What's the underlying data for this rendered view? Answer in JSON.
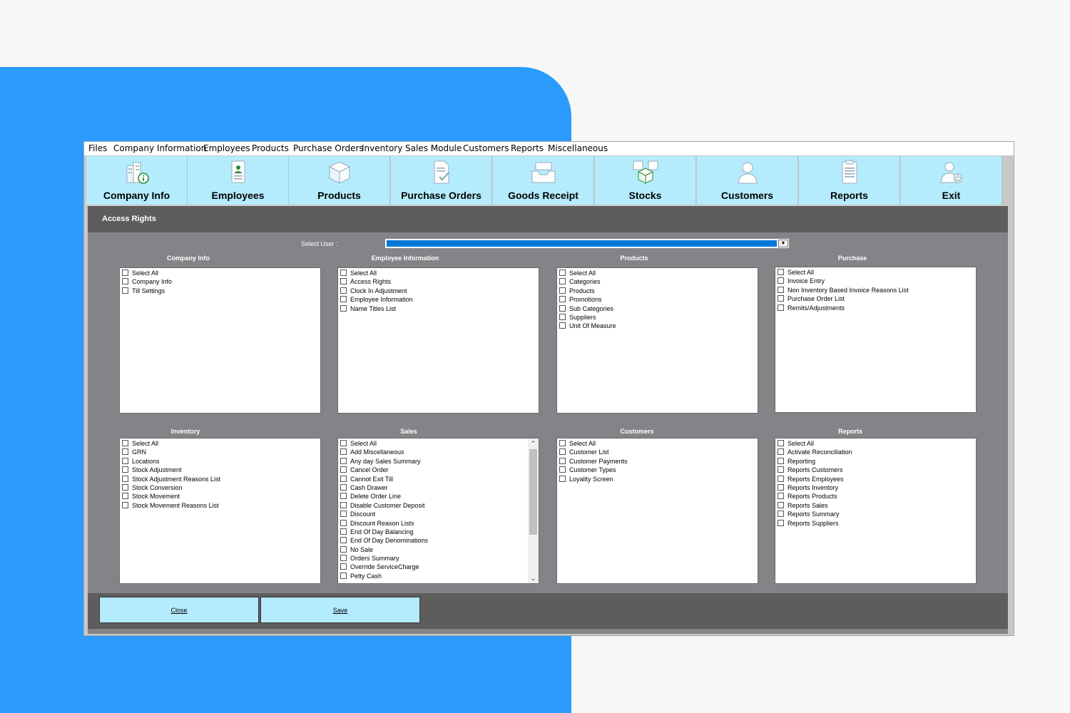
{
  "menubar": {
    "items": [
      {
        "label": "Files"
      },
      {
        "label": "Company Information"
      },
      {
        "label": "Employees"
      },
      {
        "label": "Products"
      },
      {
        "label": "Purchase Orders"
      },
      {
        "label": "Inventory"
      },
      {
        "label": "Sales Module"
      },
      {
        "label": "Customers"
      },
      {
        "label": "Reports"
      },
      {
        "label": "Miscellaneous"
      }
    ]
  },
  "toolbar": {
    "buttons": [
      {
        "label": "Company Info",
        "icon": "building-info-icon"
      },
      {
        "label": "Employees",
        "icon": "employee-badge-icon"
      },
      {
        "label": "Products",
        "icon": "product-box-icon"
      },
      {
        "label": "Purchase Orders",
        "icon": "document-check-icon"
      },
      {
        "label": "Goods Receipt",
        "icon": "inbox-tray-icon"
      },
      {
        "label": "Stocks",
        "icon": "stock-boxes-icon"
      },
      {
        "label": "Customers",
        "icon": "customer-person-icon"
      },
      {
        "label": "Reports",
        "icon": "report-clipboard-icon"
      },
      {
        "label": "Exit",
        "icon": "user-power-icon"
      }
    ]
  },
  "panel": {
    "title": "Access Rights",
    "select_user_label": "Select User :",
    "select_user_value": ""
  },
  "groups": [
    {
      "title": "Company Info",
      "items": [
        "Select All",
        "Company Info",
        "Till Settings"
      ]
    },
    {
      "title": "Employee Information",
      "items": [
        "Select All",
        "Access Rights",
        "Clock In Adjustment",
        "Employee Information",
        "Name Titles List"
      ]
    },
    {
      "title": "Products",
      "items": [
        "Select All",
        "Categories",
        "Products",
        "Promotions",
        "Sub Categories",
        "Suppliers",
        "Unit Of Measure"
      ]
    },
    {
      "title": "Purchase",
      "items": [
        "Select All",
        "Invoice Entry",
        "Non Inventory Based Invoice Reasons List",
        "Purchase Order List",
        "Remits/Adjustments"
      ]
    },
    {
      "title": "Inventory",
      "items": [
        "Select All",
        "GRN",
        "Locations",
        "Stock Adjustment",
        "Stock Adjustment Reasons List",
        "Stock Conversion",
        "Stock Movement",
        "Stock Movement Reasons List"
      ]
    },
    {
      "title": "Sales",
      "items": [
        "Select All",
        "Add Miscellaneous",
        "Any day Sales Summary",
        "Cancel Order",
        "Cannot Exit Till",
        "Cash Drawer",
        "Delete Order Line",
        "Disable Customer Deposit",
        "Discount",
        "Discount Reason Lists",
        "End Of Day Balancing",
        "End Of Day Denominations",
        "No Sale",
        "Orders Summary",
        "Override ServiceCharge",
        "Petty Cash"
      ]
    },
    {
      "title": "Customers",
      "items": [
        "Select All",
        "Customer List",
        "Customer Payments",
        "Customer Types",
        "Loyality Screen"
      ]
    },
    {
      "title": "Reports",
      "items": [
        "Select All",
        "Activate Reconciliation",
        "Reporting",
        "Reports Customers",
        "Reports Employees",
        "Reports Inventory",
        "Reports Products",
        "Reports Sales",
        "Reports Summary",
        "Reports Suppliers"
      ]
    }
  ],
  "footer": {
    "close_label": "Close",
    "save_label": "Save"
  }
}
